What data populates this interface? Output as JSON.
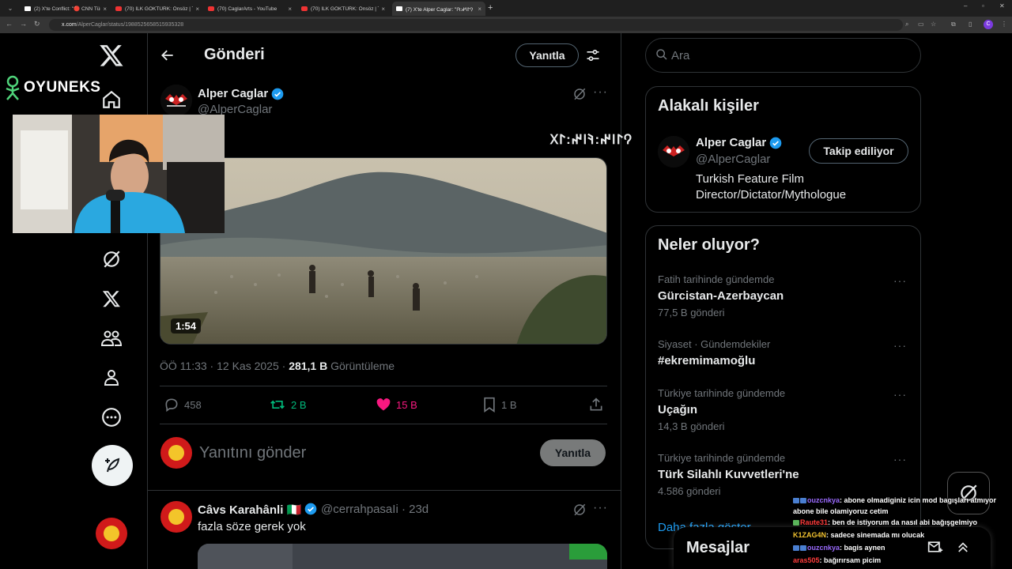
{
  "browser": {
    "tabs": [
      {
        "label": "(2) X'te Conflict: \"🔴 CNN Türk",
        "fav": "x"
      },
      {
        "label": "(70) İLK GÖKTÜRK: Önsöz | Ter",
        "fav": "yt"
      },
      {
        "label": "(70) CaglarArts - YouTube",
        "fav": "yt"
      },
      {
        "label": "(70) İLK GÖKTÜRK: Önsöz | Ter",
        "fav": "yt"
      },
      {
        "label": "(7) X'te Alper Caglar: \"𐰘𐰃𐰾𐰤:𐰚𐰾",
        "fav": "x"
      }
    ],
    "url_host": "x.com",
    "url_path": "/AlperCaglar/status/1988525658515935328"
  },
  "header": {
    "title": "Gönderi",
    "reply_label": "Yanıtla"
  },
  "post": {
    "author_name": "Alper Caglar",
    "author_handle": "@AlperCaglar",
    "text": "𐰘𐰃𐰾𐰤:𐰚𐰾𐰤:𐰃𐰓",
    "video_duration": "1:54",
    "time": "ÖÖ 11:33 · 12 Kas 2025",
    "views_count": "281,1 B",
    "views_label": "Görüntüleme",
    "stats": {
      "replies": "458",
      "reposts": "2 B",
      "likes": "15 B",
      "bookmarks": "1 B"
    }
  },
  "compose": {
    "placeholder": "Yanıtını gönder",
    "button_label": "Yanıtla"
  },
  "comment": {
    "author_name": "Câvs Karahânli 🇮🇹",
    "author_handle": "@cerrahpasaIi · 23d",
    "text": "fazla söze gerek yok"
  },
  "sidebar": {
    "search_placeholder": "Ara",
    "related": {
      "title": "Alakalı kişiler",
      "name": "Alper Caglar",
      "handle": "@AlperCaglar",
      "bio": "Turkish Feature Film Director/Dictator/Mythologue",
      "follow_label": "Takip ediliyor"
    },
    "trends": {
      "title": "Neler oluyor?",
      "items": [
        {
          "context": "Fatih tarihinde gündemde",
          "title": "Gürcistan-Azerbaycan",
          "count": "77,5 B gönderi"
        },
        {
          "context": "Siyaset · Gündemdekiler",
          "title": "#ekremimamoğlu",
          "count": ""
        },
        {
          "context": "Türkiye tarihinde gündemde",
          "title": "Uçağın",
          "count": "14,3 B gönderi"
        },
        {
          "context": "Türkiye tarihinde gündemde",
          "title": "Türk Silahlı Kuvvetleri'ne",
          "count": "4.586 gönderi"
        }
      ],
      "show_more": "Daha fazla göster"
    }
  },
  "messages": {
    "title": "Mesajlar"
  },
  "overlay": {
    "brand": "OYUNEKS",
    "chat": [
      {
        "user": "ouzcnkya",
        "color": "#9b6bff",
        "msg": ": abone olmadiginiz icin mod bagışları atmıyor"
      },
      {
        "user": "",
        "color": "#fff",
        "msg": "abone bile olamiyoruz cetim"
      },
      {
        "user": "Raute31",
        "color": "#ff3b3b",
        "msg": ": ben de istiyorum da nasıl abi bağışgelmiyo"
      },
      {
        "user": "K1ZAG4N",
        "color": "#f2c230",
        "msg": ": sadece sinemada mı olucak"
      },
      {
        "user": "ouzcnkya",
        "color": "#9b6bff",
        "msg": ": bagis aynen"
      },
      {
        "user": "aras505",
        "color": "#ff3b3b",
        "msg": ": bağırırsam picim"
      }
    ]
  },
  "colors": {
    "accent": "#1d9bf0",
    "repost": "#00ba7c",
    "like": "#f91880",
    "bg": "#000000"
  }
}
